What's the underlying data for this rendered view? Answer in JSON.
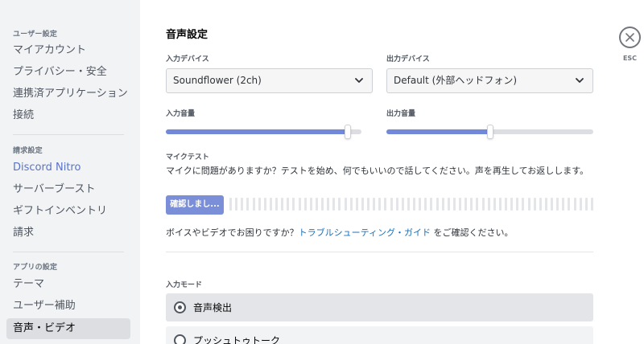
{
  "sidebar": {
    "user_settings_header": "ユーザー設定",
    "user_items": [
      {
        "label": "マイアカウント"
      },
      {
        "label": "プライバシー・安全"
      },
      {
        "label": "連携済アプリケーション"
      },
      {
        "label": "接続"
      }
    ],
    "billing_header": "請求設定",
    "billing_items": [
      {
        "label": "Discord Nitro"
      },
      {
        "label": "サーバーブースト"
      },
      {
        "label": "ギフトインベントリ"
      },
      {
        "label": "請求"
      }
    ],
    "app_settings_header": "アプリの設定",
    "app_items": [
      {
        "label": "テーマ"
      },
      {
        "label": "ユーザー補助"
      },
      {
        "label": "音声・ビデオ"
      }
    ]
  },
  "main": {
    "title": "音声設定",
    "input_device": {
      "label": "入力デバイス",
      "value": "Soundflower (2ch)"
    },
    "output_device": {
      "label": "出力デバイス",
      "value": "Default (外部ヘッドフォン)"
    },
    "input_volume": {
      "label": "入力音量",
      "level": 0.93
    },
    "output_volume": {
      "label": "出力音量",
      "level": 0.5
    },
    "mic_test": {
      "label": "マイクテスト",
      "description": "マイクに問題がありますか？テストを始め、何でもいいので話してください。声を再生してお返しします。",
      "button": "確認しまし..."
    },
    "help": {
      "prefix": "ボイスやビデオでお困りですか？",
      "link": "トラブルシューティング・ガイド",
      "suffix": " をご確認ください。"
    },
    "input_mode": {
      "label": "入力モード",
      "options": [
        {
          "label": "音声検出",
          "selected": true
        },
        {
          "label": "プッシュトゥトーク",
          "selected": false
        }
      ]
    },
    "close": {
      "esc_label": "ESC"
    }
  },
  "colors": {
    "accent": "#7289da",
    "link": "#1c6fb5",
    "sidebar_bg": "#f2f3f5"
  }
}
